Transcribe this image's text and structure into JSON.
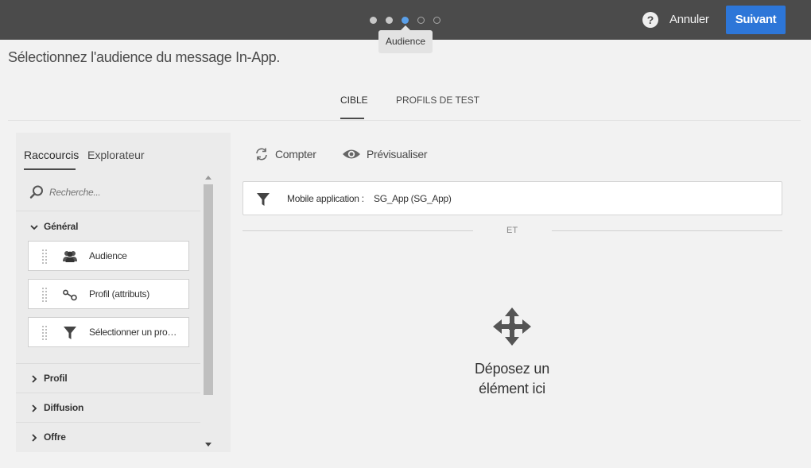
{
  "wizard": {
    "steps": [
      {
        "state": "done"
      },
      {
        "state": "done"
      },
      {
        "state": "active"
      },
      {
        "state": "todo"
      },
      {
        "state": "todo"
      }
    ],
    "tooltip": "Audience",
    "help_label": "?",
    "cancel_label": "Annuler",
    "next_label": "Suivant"
  },
  "page": {
    "title": "Sélectionnez l'audience du message In-App."
  },
  "tabs": [
    {
      "label": "CIBLE",
      "active": true
    },
    {
      "label": "PROFILS DE TEST",
      "active": false
    }
  ],
  "palette": {
    "tabs": [
      {
        "label": "Raccourcis",
        "active": true
      },
      {
        "label": "Explorateur",
        "active": false
      }
    ],
    "search": {
      "placeholder": "Recherche..."
    },
    "sections": [
      {
        "label": "Général",
        "expanded": true,
        "items": [
          {
            "label": "Audience",
            "icon": "audience-icon"
          },
          {
            "label": "Profil (attributs)",
            "icon": "profile-attributes-icon"
          },
          {
            "label": "Sélectionner un pro…",
            "icon": "filter-icon"
          }
        ]
      },
      {
        "label": "Profil",
        "expanded": false
      },
      {
        "label": "Diffusion",
        "expanded": false
      },
      {
        "label": "Offre",
        "expanded": false
      }
    ]
  },
  "workspace": {
    "count_label": "Compter",
    "preview_label": "Prévisualiser",
    "query": {
      "label": "Mobile application :",
      "value": "SG_App (SG_App)"
    },
    "operator": "ET",
    "drop_zone": {
      "line1": "Déposez un",
      "line2": "élément ici"
    }
  },
  "colors": {
    "topbar": "#4b4b4b",
    "accent": "#2d76d8",
    "active_step": "#5aa0ea"
  }
}
